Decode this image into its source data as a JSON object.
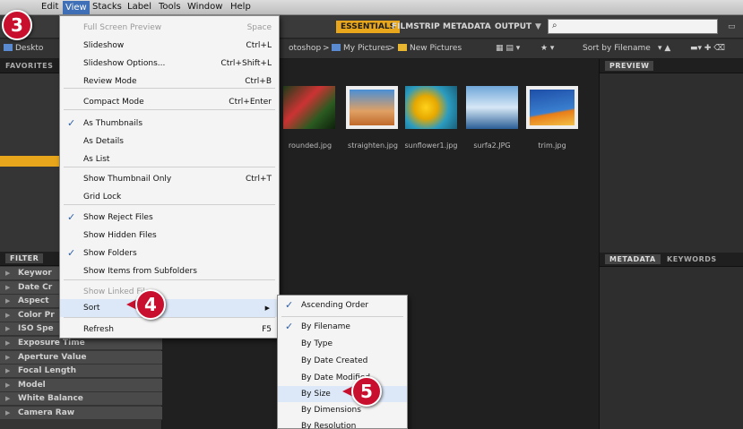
{
  "menubar": {
    "items": [
      "Edit",
      "View",
      "Stacks",
      "Label",
      "Tools",
      "Window",
      "Help"
    ]
  },
  "workspace": {
    "buttons": [
      "ESSENTIALS",
      "FILMSTRIP",
      "METADATA",
      "OUTPUT"
    ],
    "search_icon": "search-icon"
  },
  "path": {
    "left": "Deskto",
    "seg1": "otoshop",
    "seg2": "My Pictures",
    "seg3": "New Pictures",
    "sort": "Sort by Filename"
  },
  "panels": {
    "favorites": "FAVORITES",
    "preview": "PREVIEW",
    "filter": "FILTER",
    "metadata": "METADATA",
    "keywords": "KEYWORDS"
  },
  "filters": [
    "Keywor",
    "Date Cr",
    "Aspect",
    "Color Pr",
    "ISO Spe",
    "Exposure Time",
    "Aperture Value",
    "Focal Length",
    "Model",
    "White Balance",
    "Camera Raw"
  ],
  "thumbs": [
    {
      "caption": "rounded.jpg"
    },
    {
      "caption": "straighten.jpg"
    },
    {
      "caption": "sunflower1.jpg"
    },
    {
      "caption": "surfa2.JPG"
    },
    {
      "caption": "trim.jpg"
    }
  ],
  "view_menu": {
    "items": [
      {
        "label": "Full Screen Preview",
        "shortcut": "Space"
      },
      {
        "label": "Slideshow",
        "shortcut": "Ctrl+L"
      },
      {
        "label": "Slideshow Options...",
        "shortcut": "Ctrl+Shift+L"
      },
      {
        "label": "Review Mode",
        "shortcut": "Ctrl+B"
      },
      {
        "label": "Compact Mode",
        "shortcut": "Ctrl+Enter"
      },
      {
        "label": "As Thumbnails",
        "shortcut": ""
      },
      {
        "label": "As Details",
        "shortcut": ""
      },
      {
        "label": "As List",
        "shortcut": ""
      },
      {
        "label": "Show Thumbnail Only",
        "shortcut": "Ctrl+T"
      },
      {
        "label": "Grid Lock",
        "shortcut": ""
      },
      {
        "label": "Show Reject Files",
        "shortcut": ""
      },
      {
        "label": "Show Hidden Files",
        "shortcut": ""
      },
      {
        "label": "Show Folders",
        "shortcut": ""
      },
      {
        "label": "Show Items from Subfolders",
        "shortcut": ""
      },
      {
        "label": "Show Linked Files",
        "shortcut": ""
      },
      {
        "label": "Sort",
        "shortcut": ""
      },
      {
        "label": "Refresh",
        "shortcut": "F5"
      }
    ]
  },
  "sort_menu": {
    "items": [
      "Ascending Order",
      "By Filename",
      "By Type",
      "By Date Created",
      "By Date Modified",
      "By Size",
      "By Dimensions",
      "By Resolution"
    ]
  },
  "steps": [
    "3",
    "4",
    "5"
  ],
  "colors": {
    "accent": "#e7a61c",
    "badge": "#c8102e",
    "highlight": "#dce8f7"
  }
}
